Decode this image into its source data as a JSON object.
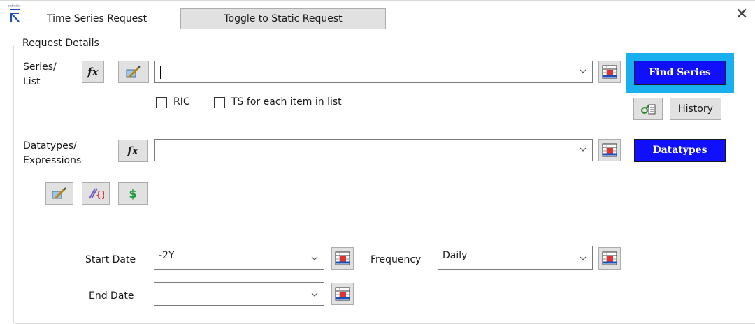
{
  "window": {
    "title": "Time Series Request",
    "logo_text": "refinitiv",
    "toggle_button": "Toggle to Static Request",
    "close_icon": "close-icon"
  },
  "request_details": {
    "legend": "Request Details",
    "series": {
      "label_line1": "Series/",
      "label_line2": "List",
      "value": "",
      "find_button": "Find Series",
      "ric_label": "RIC",
      "ric_checked": false,
      "ts_each_label": "TS for each item in list",
      "ts_each_checked": false,
      "history_button": "History"
    },
    "datatypes": {
      "label_line1": "Datatypes/",
      "label_line2": "Expressions",
      "value": "",
      "button": "Datatypes"
    },
    "start_date": {
      "label": "Start Date",
      "value": "-2Y"
    },
    "frequency": {
      "label": "Frequency",
      "value": "Daily"
    },
    "end_date": {
      "label": "End Date",
      "value": ""
    }
  },
  "colors": {
    "accent_blue": "#1010ff",
    "highlight_cyan": "#1ab0f0",
    "currency_green": "#1c9b3c"
  }
}
